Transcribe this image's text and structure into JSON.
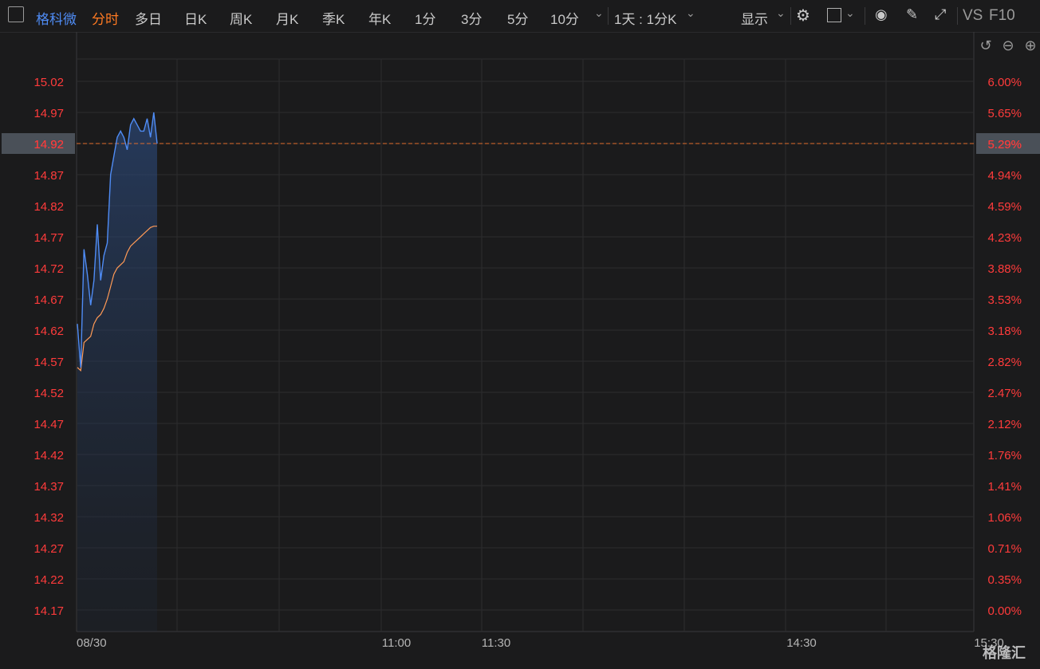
{
  "toolbar": {
    "stock_name": "格科微",
    "tabs": [
      "分时",
      "多日",
      "日K",
      "周K",
      "月K",
      "季K",
      "年K",
      "1分",
      "3分",
      "5分",
      "10分"
    ],
    "period_select": "1天 : 1分K",
    "display_label": "显示",
    "vs_label": "VS",
    "f10_label": "F10"
  },
  "watermark": "格隆汇",
  "colors": {
    "price_line": "#4f8cf5",
    "avg_line": "#ff9a56",
    "axis_text": "#ff3b3b",
    "current_line": "#e06d2c",
    "grid": "#2c2c2e"
  },
  "chart_data": {
    "type": "line",
    "x_labels": [
      "08/30",
      "11:00",
      "11:30",
      "14:30",
      "15:30"
    ],
    "y_left_ticks": [
      "15.02",
      "14.97",
      "14.92",
      "14.87",
      "14.82",
      "14.77",
      "14.72",
      "14.67",
      "14.62",
      "14.57",
      "14.52",
      "14.47",
      "14.42",
      "14.37",
      "14.32",
      "14.27",
      "14.22",
      "14.17"
    ],
    "y_right_ticks": [
      "6.00%",
      "5.65%",
      "5.29%",
      "4.94%",
      "4.59%",
      "4.23%",
      "3.88%",
      "3.53%",
      "3.18%",
      "2.82%",
      "2.47%",
      "2.12%",
      "1.76%",
      "1.41%",
      "1.06%",
      "0.71%",
      "0.35%",
      "0.00%"
    ],
    "ylim": [
      14.17,
      15.02
    ],
    "current_price": "14.92",
    "current_pct": "5.29%",
    "series": [
      {
        "values": [
          14.63,
          14.56,
          14.75,
          14.71,
          14.66,
          14.7,
          14.79,
          14.7,
          14.74,
          14.76,
          14.87,
          14.9,
          14.93,
          14.94,
          14.93,
          14.91,
          14.95,
          14.96,
          14.95,
          14.94,
          14.94,
          14.96,
          14.93,
          14.97,
          14.92
        ]
      },
      {
        "values": [
          14.56,
          14.555,
          14.6,
          14.605,
          14.61,
          14.63,
          14.64,
          14.645,
          14.655,
          14.67,
          14.69,
          14.71,
          14.72,
          14.725,
          14.73,
          14.745,
          14.755,
          14.76,
          14.765,
          14.77,
          14.775,
          14.78,
          14.785,
          14.787,
          14.787
        ]
      }
    ]
  }
}
